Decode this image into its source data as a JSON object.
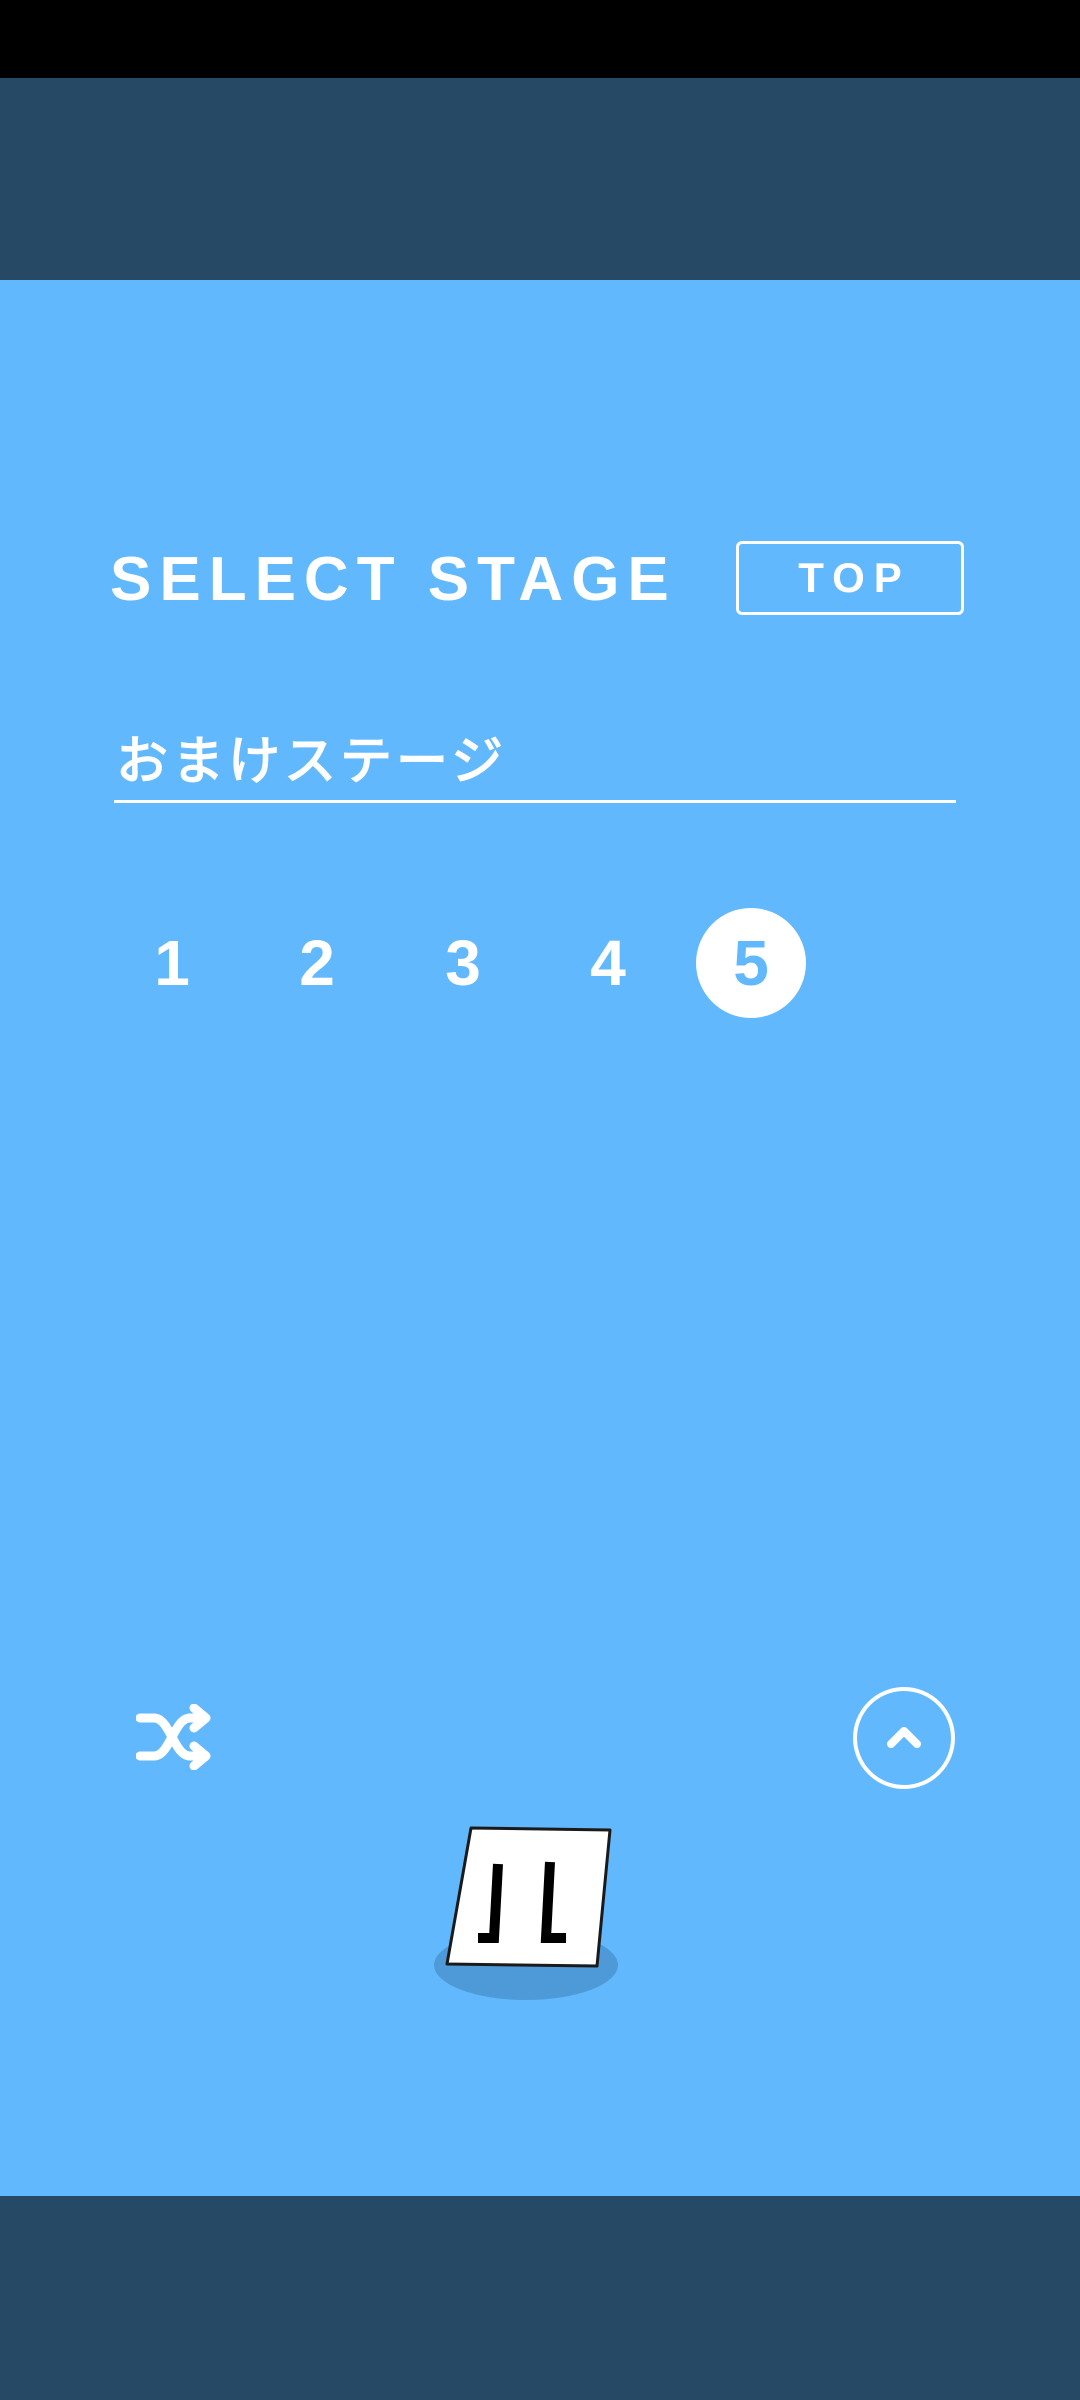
{
  "header": {
    "title": "SELECT STAGE",
    "top_button_label": "TOP"
  },
  "category": {
    "label": "おまけステージ"
  },
  "stages": [
    {
      "label": "1",
      "selected": false
    },
    {
      "label": "2",
      "selected": false
    },
    {
      "label": "3",
      "selected": false
    },
    {
      "label": "4",
      "selected": false
    },
    {
      "label": "5",
      "selected": true
    }
  ],
  "controls": {
    "shuffle_icon": "shuffle-icon",
    "up_icon": "chevron-up-icon"
  },
  "colors": {
    "background": "#62b8fd",
    "band": "#264a66",
    "accent": "#ffffff"
  }
}
